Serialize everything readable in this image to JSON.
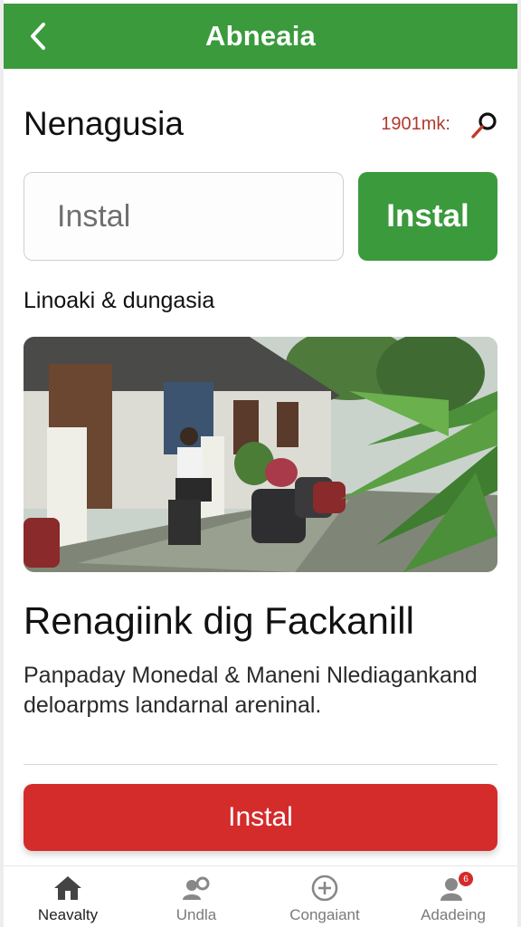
{
  "header": {
    "title": "Abneaia",
    "back_icon": "chevron-left-icon"
  },
  "section": {
    "title": "Nenagusia",
    "meta": "1901mk:",
    "search_icon": "search-icon"
  },
  "search": {
    "placeholder": "Instal",
    "button_label": "Instal"
  },
  "subheading": "Linoaki & dungasia",
  "photo": {
    "alt_icon": "photo-image"
  },
  "article": {
    "title": "Renagiink dig  Fackanill",
    "body": "Panpaday Monedal & Maneni Nlediagankand deloarpms landarnal areninal."
  },
  "action": {
    "button_label": "Instal"
  },
  "bottom_nav": {
    "items": [
      {
        "label": "Neavalty",
        "icon": "home-icon",
        "active": true
      },
      {
        "label": "Undla",
        "icon": "user-search-icon",
        "active": false
      },
      {
        "label": "Congaiant",
        "icon": "plus-circle-icon",
        "active": false
      },
      {
        "label": "Adadeing",
        "icon": "profile-icon",
        "active": false,
        "badge": "6"
      }
    ]
  },
  "colors": {
    "primary_green": "#3a9a3c",
    "accent_red": "#d42b2b",
    "meta_red": "#b03a2e"
  }
}
